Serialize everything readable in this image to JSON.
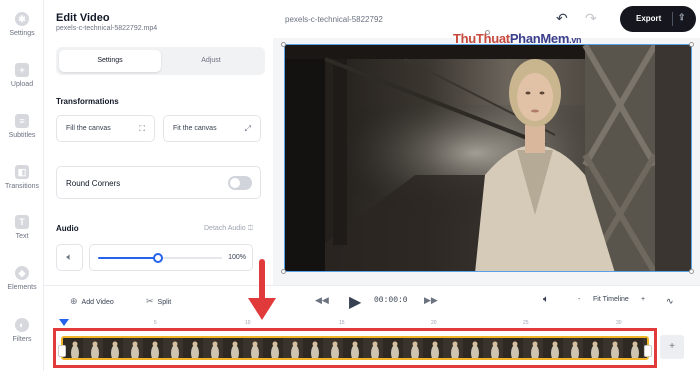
{
  "sidebar": {
    "items": [
      {
        "label": "Settings",
        "icon": "gear-icon"
      },
      {
        "label": "Upload",
        "icon": "plus-icon"
      },
      {
        "label": "Subtitles",
        "icon": "subtitles-icon"
      },
      {
        "label": "Transitions",
        "icon": "transitions-icon"
      },
      {
        "label": "Text",
        "icon": "text-icon"
      },
      {
        "label": "Elements",
        "icon": "elements-icon"
      },
      {
        "label": "Filters",
        "icon": "filters-icon"
      }
    ]
  },
  "panel": {
    "title": "Edit Video",
    "subtitle": "pexels-c-technical-5822792.mp4",
    "tabs": [
      "Settings",
      "Adjust"
    ],
    "transformations_title": "Transformations",
    "fill_label": "Fill the canvas",
    "fit_label": "Fit the canvas",
    "round_corners_label": "Round Corners",
    "audio_title": "Audio",
    "detach_audio_label": "Detach Audio",
    "volume": {
      "value": 1.0,
      "display": "100%",
      "handle_fraction": 0.48
    }
  },
  "topbar": {
    "file_name": "pexels-c-technical-5822792",
    "export_label": "Export",
    "undo_icon": "undo-icon",
    "redo_icon": "redo-icon",
    "export_icon": "upload-icon"
  },
  "watermark": {
    "part1": "ThuThuat",
    "part2": "PhanMem",
    "suffix": ".vn"
  },
  "toolbar": {
    "add_video_label": "Add Video",
    "split_label": "Split",
    "time": "00:00:0",
    "zoom_label": "Fit Timeline",
    "minus": "-",
    "plus": "+"
  },
  "timeline": {
    "ticks": [
      "0",
      "5",
      "10",
      "15",
      "20",
      "25",
      "30"
    ],
    "add_label": "+"
  },
  "colors": {
    "accent": "#2563eb",
    "export_bg": "#15161e",
    "highlight_red": "#e13a3a",
    "track_gold": "#f0b429"
  }
}
